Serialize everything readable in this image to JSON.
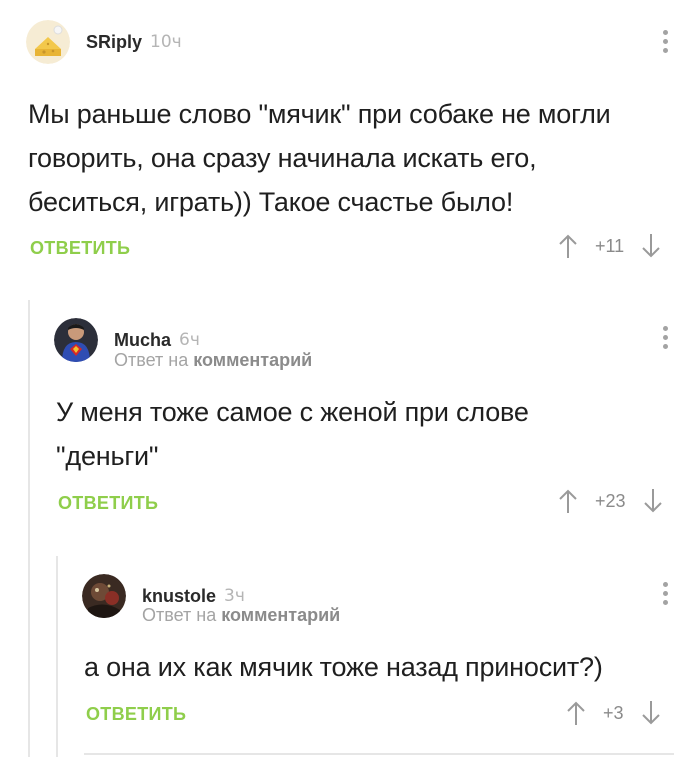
{
  "comments": [
    {
      "username": "SRiply",
      "time": "10ч",
      "text_lines": [
        "Мы раньше слово \"мячик\" при собаке не могли",
        "говорить, она сразу начинала искать его,",
        "беситься, играть)) Такое счастье было!"
      ],
      "reply_label": "ОТВЕТИТЬ",
      "score": "+11"
    },
    {
      "username": "Mucha",
      "time": "6ч",
      "reply_to_prefix": "Ответ на",
      "reply_to_target": "комментарий",
      "text_lines": [
        "У меня тоже самое с женой при слове",
        "\"деньги\""
      ],
      "reply_label": "ОТВЕТИТЬ",
      "score": "+23"
    },
    {
      "username": "knustole",
      "time": "3ч",
      "reply_to_prefix": "Ответ на",
      "reply_to_target": "комментарий",
      "text_lines": [
        "а она их как мячик тоже назад приносит?)"
      ],
      "reply_label": "ОТВЕТИТЬ",
      "score": "+3"
    }
  ],
  "colors": {
    "accent_green": "#8fce4b",
    "muted_gray": "#a4a4a4"
  },
  "icons": [
    "cheese-avatar",
    "superman-avatar",
    "dark-avatar",
    "more-vertical-icon",
    "arrow-up-icon",
    "arrow-down-icon"
  ]
}
